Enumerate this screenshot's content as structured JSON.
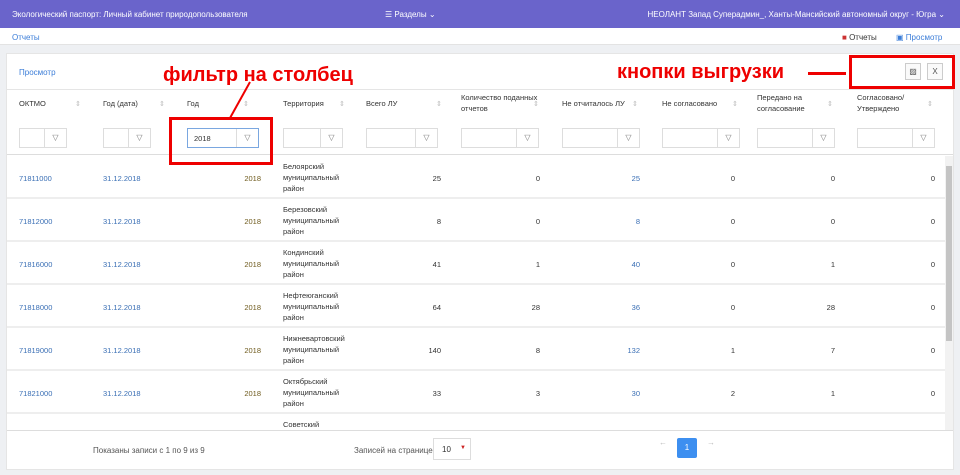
{
  "header": {
    "app_title": "Экологический паспорт: Личный кабинет природопользователя",
    "menu": "Разделы",
    "user": "НЕОЛАНТ Запад Суперадмин_, Ханты-Мансийский автономный округ - Югра"
  },
  "subnav": {
    "breadcrumb": "Отчеты",
    "reports": "Отчеты",
    "view": "Просмотр"
  },
  "card": {
    "title": "Просмотр",
    "export_image": "image-export-icon",
    "export_excel": "excel-export-icon"
  },
  "columns": [
    "ОКТМО",
    "Год (дата)",
    "Год",
    "Территория",
    "Всего ЛУ",
    "Количество поданных отчетов",
    "Не отчиталось ЛУ",
    "Не согласовано",
    "Передано на согласование",
    "Согласовано/ Утверждено"
  ],
  "filters": {
    "year": "2018"
  },
  "rows": [
    {
      "oktmo": "71811000",
      "date": "31.12.2018",
      "year": "2018",
      "territory": "Белоярский муниципальный район",
      "total": "25",
      "submitted": "0",
      "not_reported": "25",
      "not_agreed": "0",
      "sent": "0",
      "approved": "0"
    },
    {
      "oktmo": "71812000",
      "date": "31.12.2018",
      "year": "2018",
      "territory": "Березовский муниципальный район",
      "total": "8",
      "submitted": "0",
      "not_reported": "8",
      "not_agreed": "0",
      "sent": "0",
      "approved": "0"
    },
    {
      "oktmo": "71816000",
      "date": "31.12.2018",
      "year": "2018",
      "territory": "Кондинский муниципальный район",
      "total": "41",
      "submitted": "1",
      "not_reported": "40",
      "not_agreed": "0",
      "sent": "1",
      "approved": "0"
    },
    {
      "oktmo": "71818000",
      "date": "31.12.2018",
      "year": "2018",
      "territory": "Нефтеюганский муниципальный район",
      "total": "64",
      "submitted": "28",
      "not_reported": "36",
      "not_agreed": "0",
      "sent": "28",
      "approved": "0"
    },
    {
      "oktmo": "71819000",
      "date": "31.12.2018",
      "year": "2018",
      "territory": "Нижневартовский муниципальный район",
      "total": "140",
      "submitted": "8",
      "not_reported": "132",
      "not_agreed": "1",
      "sent": "7",
      "approved": "0"
    },
    {
      "oktmo": "71821000",
      "date": "31.12.2018",
      "year": "2018",
      "territory": "Октябрьский муниципальный район",
      "total": "33",
      "submitted": "3",
      "not_reported": "30",
      "not_agreed": "2",
      "sent": "1",
      "approved": "0"
    },
    {
      "oktmo": "",
      "date": "",
      "year": "",
      "territory": "Советский",
      "total": "",
      "submitted": "",
      "not_reported": "",
      "not_agreed": "",
      "sent": "",
      "approved": ""
    }
  ],
  "footer": {
    "info": "Показаны записи с 1 по 9 из 9",
    "per_page_label": "Записей на странице",
    "per_page": "10",
    "prev": "←",
    "page": "1",
    "next": "→"
  },
  "annotations": {
    "filter": "фильтр на столбец",
    "export": "кнопки выгрузки"
  }
}
